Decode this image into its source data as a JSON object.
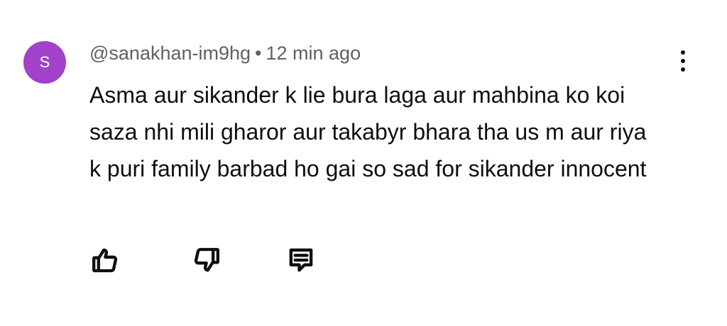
{
  "comment": {
    "avatar_letter": "S",
    "avatar_color": "#a142c8",
    "handle": "@sanakhan-im9hg",
    "separator": "•",
    "time_ago": "12 min ago",
    "text": "Asma aur sikander k lie bura laga aur mahbina ko koi saza nhi mili gharor aur takabyr bhara tha us m aur riya k puri family barbad ho gai so sad for sikander innocent",
    "menu_icon": "more-vertical-icon",
    "actions": [
      {
        "name": "like",
        "icon": "thumbs-up-icon"
      },
      {
        "name": "dislike",
        "icon": "thumbs-down-icon"
      },
      {
        "name": "reply",
        "icon": "reply-comment-icon"
      }
    ]
  },
  "colors": {
    "text_primary": "#0f0f0f",
    "text_secondary": "#606060",
    "background": "#ffffff"
  }
}
